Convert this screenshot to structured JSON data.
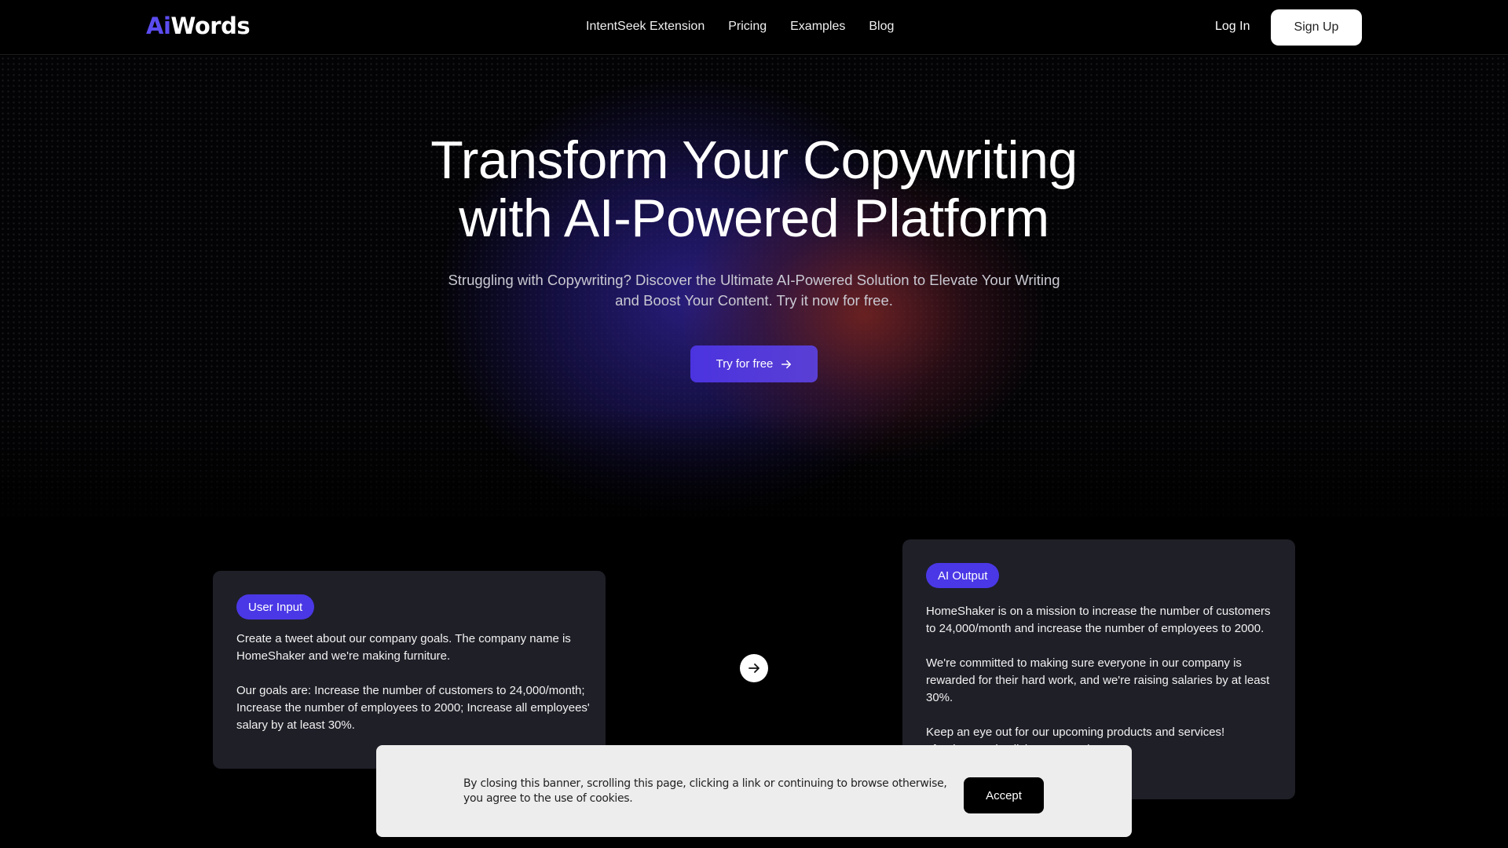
{
  "nav": {
    "logo": {
      "prefix": "Ai",
      "suffix": "Words"
    },
    "links": [
      "IntentSeek Extension",
      "Pricing",
      "Examples",
      "Blog"
    ],
    "login_label": "Log In",
    "signup_label": "Sign Up"
  },
  "hero": {
    "headline_line1": "Transform Your Copywriting",
    "headline_line2": "with AI-Powered Platform",
    "subhead": "Struggling with Copywriting? Discover the Ultimate AI-Powered Solution to Elevate Your Writing and Boost Your Content. Try it now for free.",
    "cta_label": "Try for free",
    "cta_icon": "arrow-right-icon"
  },
  "demo": {
    "input": {
      "badge": "User Input",
      "paragraphs": [
        "Create a tweet about our company goals. The company name is HomeShaker and we're making furniture.",
        "Our goals are: Increase the number of customers to 24,000/month; Increase the number of employees to 2000; Increase all employees' salary by at least 30%."
      ]
    },
    "arrow_icon": "arrow-right-icon",
    "output": {
      "badge": "AI Output",
      "paragraphs": [
        "HomeShaker is on a mission to increase the number of customers to 24,000/month and increase the number of employees to 2000.",
        "We're committed to making sure everyone in our company is rewarded for their hard work, and we're raising salaries by at least 30%.",
        "Keep an eye out for our upcoming products and services!"
      ],
      "hashtags": "#furnituregoals #livingroomgoals"
    }
  },
  "cookie_banner": {
    "text": "By closing this banner, scrolling this page, clicking a link or continuing to browse otherwise, you agree to the use of cookies.",
    "accept_label": "Accept"
  },
  "colors": {
    "accent": "#4a38e6",
    "background": "#000000",
    "card": "#1f1f28",
    "banner": "#ededed"
  }
}
